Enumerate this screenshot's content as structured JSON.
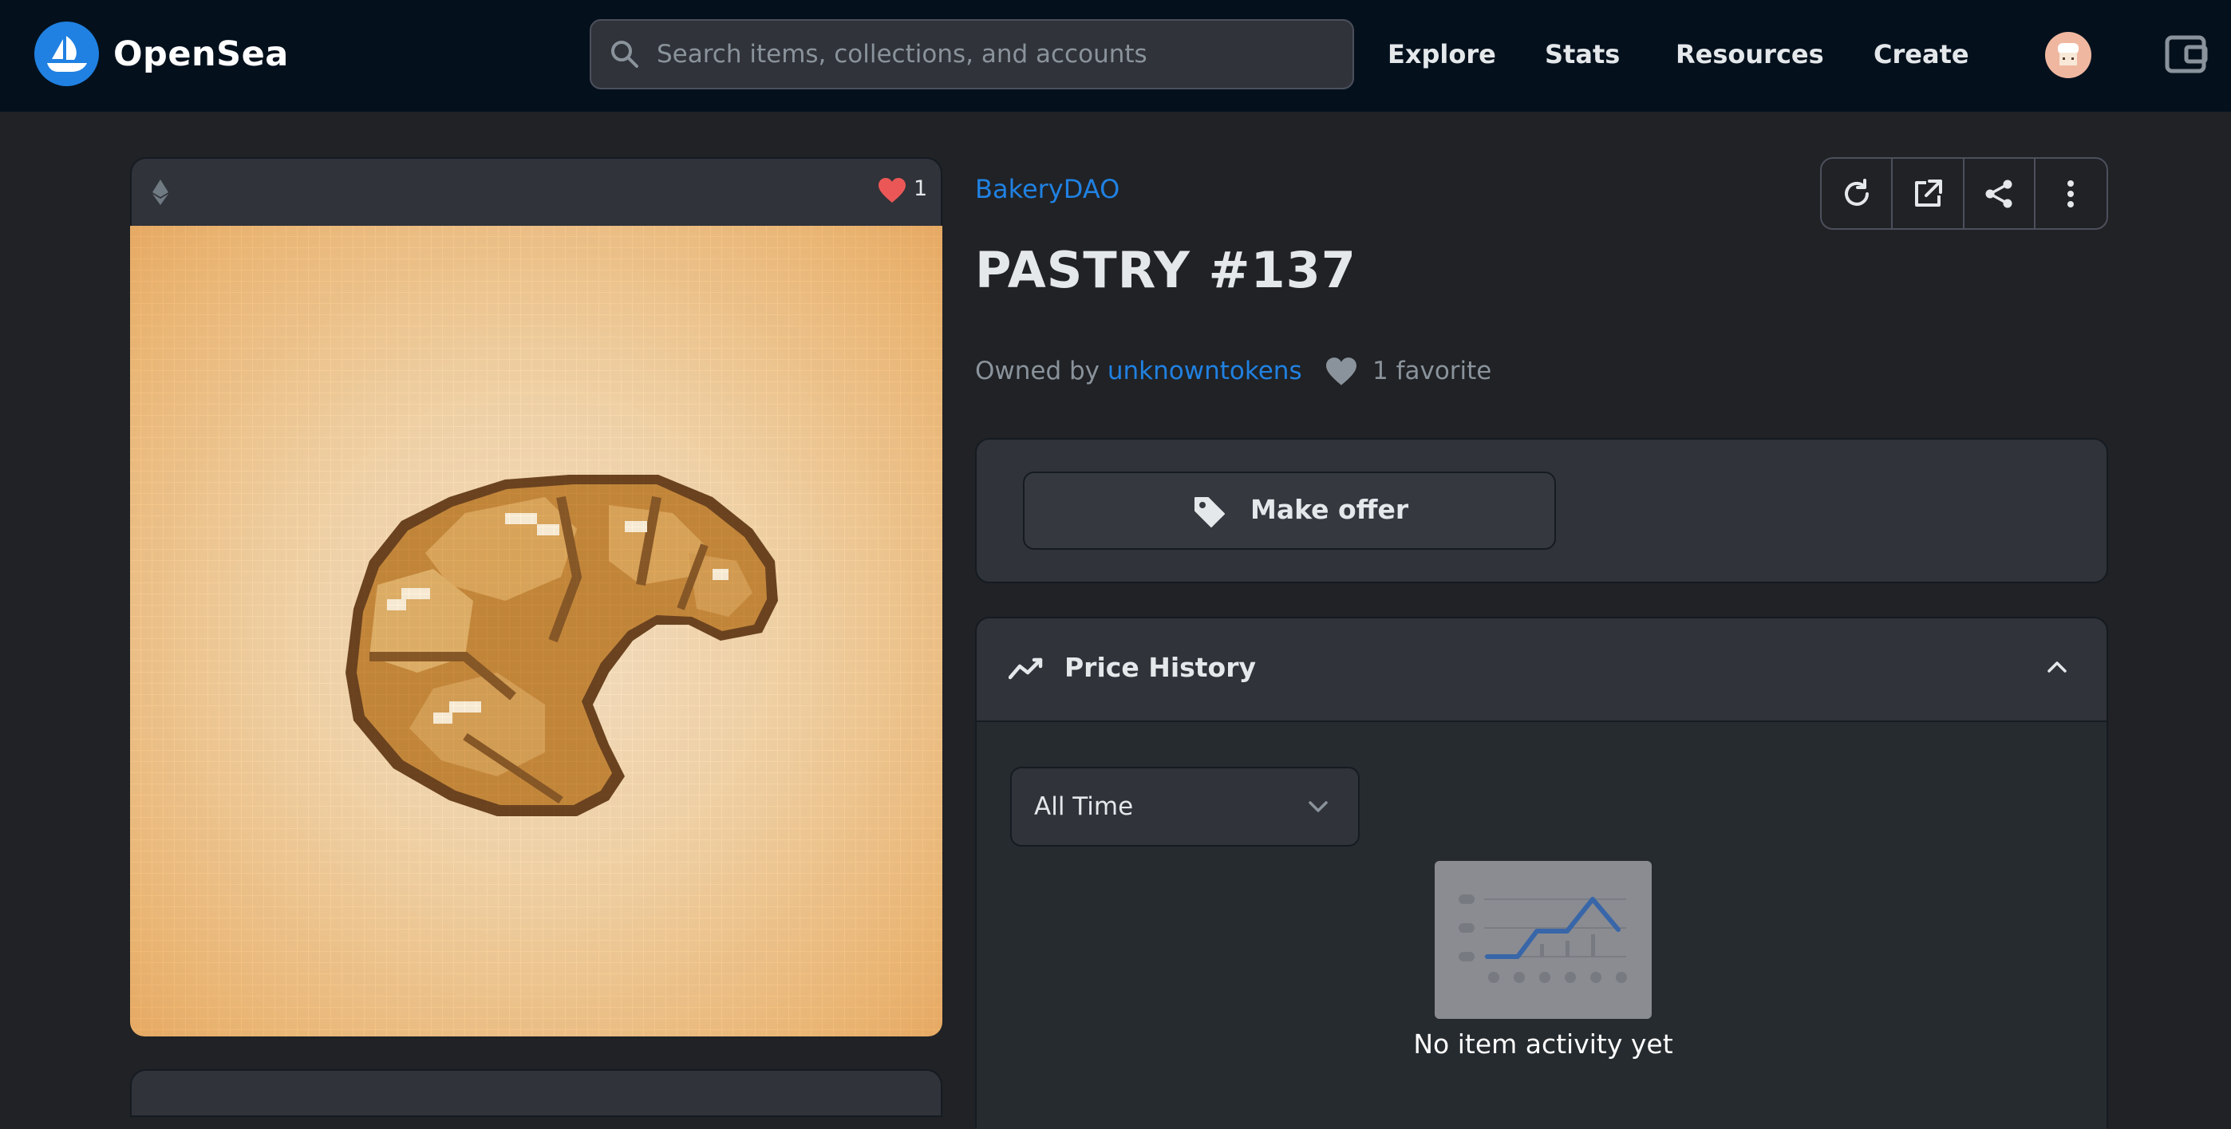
{
  "nav": {
    "brand": "OpenSea",
    "search_placeholder": "Search items, collections, and accounts",
    "links": [
      "Explore",
      "Stats",
      "Resources",
      "Create"
    ]
  },
  "card": {
    "favorites_count": "1"
  },
  "item": {
    "collection": "BakeryDAO",
    "title": "PASTRY #137",
    "owned_by_label": "Owned by",
    "owner": "unknowntokens",
    "favorites_label": "1 favorite"
  },
  "offer": {
    "label": "Make offer"
  },
  "price_history": {
    "title": "Price History",
    "range_selected": "All Time",
    "empty_message": "No item activity yet"
  },
  "colors": {
    "accent": "#2081e2",
    "nav_bg": "#04111d",
    "page_bg": "#202225",
    "heart": "#eb5757"
  }
}
